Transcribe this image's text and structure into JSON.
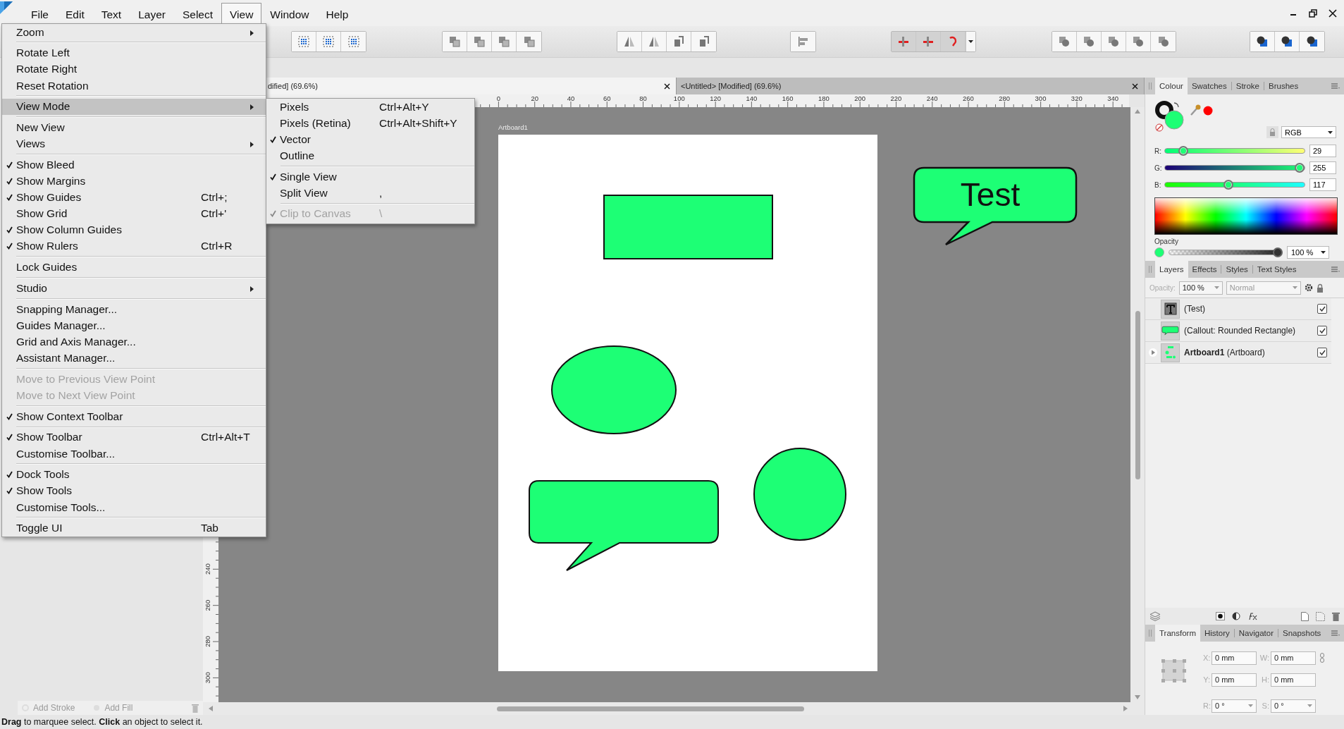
{
  "menubar": [
    {
      "label": "File",
      "selected": false
    },
    {
      "label": "Edit",
      "selected": false
    },
    {
      "label": "Text",
      "selected": false
    },
    {
      "label": "Layer",
      "selected": false
    },
    {
      "label": "Select",
      "selected": false
    },
    {
      "label": "View",
      "selected": true
    },
    {
      "label": "Window",
      "selected": false
    },
    {
      "label": "Help",
      "selected": false
    }
  ],
  "view_menu": {
    "groups": [
      [
        {
          "label": "Zoom",
          "checked": false,
          "disabled": false,
          "selected": false,
          "submenu": true
        }
      ],
      [
        {
          "label": "Rotate Left",
          "checked": false,
          "disabled": false,
          "selected": false,
          "submenu": false
        },
        {
          "label": "Rotate Right",
          "checked": false,
          "disabled": false,
          "selected": false,
          "submenu": false
        },
        {
          "label": "Reset Rotation",
          "checked": false,
          "disabled": false,
          "selected": false,
          "submenu": false
        }
      ],
      [
        {
          "label": "View Mode",
          "checked": false,
          "disabled": false,
          "selected": true,
          "submenu": true
        }
      ],
      [
        {
          "label": "New View",
          "checked": false,
          "disabled": false,
          "selected": false,
          "submenu": false
        },
        {
          "label": "Views",
          "checked": false,
          "disabled": false,
          "selected": false,
          "submenu": true
        }
      ],
      [
        {
          "label": "Show Bleed",
          "checked": true,
          "disabled": false,
          "selected": false,
          "submenu": false
        },
        {
          "label": "Show Margins",
          "checked": true,
          "disabled": false,
          "selected": false,
          "submenu": false
        },
        {
          "label": "Show Guides",
          "shortcut": "Ctrl+;",
          "checked": true,
          "disabled": false,
          "selected": false,
          "submenu": false
        },
        {
          "label": "Show Grid",
          "shortcut": "Ctrl+'",
          "checked": false,
          "disabled": false,
          "selected": false,
          "submenu": false
        },
        {
          "label": "Show Column Guides",
          "checked": true,
          "disabled": false,
          "selected": false,
          "submenu": false
        },
        {
          "label": "Show Rulers",
          "shortcut": "Ctrl+R",
          "checked": true,
          "disabled": false,
          "selected": false,
          "submenu": false
        }
      ],
      [
        {
          "label": "Lock Guides",
          "checked": false,
          "disabled": false,
          "selected": false,
          "submenu": false
        }
      ],
      [
        {
          "label": "Studio",
          "checked": false,
          "disabled": false,
          "selected": false,
          "submenu": true
        }
      ],
      [
        {
          "label": "Snapping Manager...",
          "checked": false,
          "disabled": false,
          "selected": false,
          "submenu": false
        },
        {
          "label": "Guides Manager...",
          "checked": false,
          "disabled": false,
          "selected": false,
          "submenu": false
        },
        {
          "label": "Grid and Axis Manager...",
          "checked": false,
          "disabled": false,
          "selected": false,
          "submenu": false
        },
        {
          "label": "Assistant Manager...",
          "checked": false,
          "disabled": false,
          "selected": false,
          "submenu": false
        }
      ],
      [
        {
          "label": "Move to Previous View Point",
          "checked": false,
          "disabled": true,
          "selected": false,
          "submenu": false
        },
        {
          "label": "Move to Next View Point",
          "checked": false,
          "disabled": true,
          "selected": false,
          "submenu": false
        }
      ],
      [
        {
          "label": "Show Context Toolbar",
          "checked": true,
          "disabled": false,
          "selected": false,
          "submenu": false
        }
      ],
      [
        {
          "label": "Show Toolbar",
          "shortcut": "Ctrl+Alt+T",
          "checked": true,
          "disabled": false,
          "selected": false,
          "submenu": false
        },
        {
          "label": "Customise Toolbar...",
          "checked": false,
          "disabled": false,
          "selected": false,
          "submenu": false
        }
      ],
      [
        {
          "label": "Dock Tools",
          "checked": true,
          "disabled": false,
          "selected": false,
          "submenu": false
        },
        {
          "label": "Show Tools",
          "checked": true,
          "disabled": false,
          "selected": false,
          "submenu": false
        },
        {
          "label": "Customise Tools...",
          "checked": false,
          "disabled": false,
          "selected": false,
          "submenu": false
        }
      ],
      [
        {
          "label": "Toggle UI",
          "shortcut": "Tab",
          "checked": false,
          "disabled": false,
          "selected": false,
          "submenu": false
        }
      ]
    ]
  },
  "view_mode_submenu": {
    "groups": [
      [
        {
          "label": "Pixels",
          "shortcut": "Ctrl+Alt+Y",
          "checked": false,
          "disabled": false
        },
        {
          "label": "Pixels (Retina)",
          "shortcut": "Ctrl+Alt+Shift+Y",
          "checked": false,
          "disabled": false
        },
        {
          "label": "Vector",
          "checked": true,
          "disabled": false
        },
        {
          "label": "Outline",
          "checked": false,
          "disabled": false
        }
      ],
      [
        {
          "label": "Single View",
          "checked": true,
          "disabled": false
        },
        {
          "label": "Split View",
          "shortcut": ",",
          "checked": false,
          "disabled": false
        }
      ],
      [
        {
          "label": "Clip to Canvas",
          "shortcut": "\\",
          "checked": true,
          "disabled": true
        }
      ]
    ]
  },
  "document_tabs": [
    {
      "title": "dified] (69.6%)",
      "selected": true
    },
    {
      "title": "<Untitled> [Modified] (69.6%)",
      "selected": false
    }
  ],
  "rulers": {
    "x_labels": [
      "0",
      "20",
      "40",
      "60",
      "80",
      "100",
      "120",
      "140",
      "160",
      "180",
      "200",
      "220",
      "240",
      "260",
      "280",
      "300",
      "320",
      "340"
    ],
    "y_labels": [
      "240",
      "260",
      "280",
      "300"
    ]
  },
  "canvas": {
    "artboard_label": "Artboard1",
    "callout_text": "Test"
  },
  "appearance_bar": {
    "add_stroke": "Add Stroke",
    "add_fill": "Add Fill"
  },
  "colour_panel": {
    "tabs": [
      {
        "label": "Colour",
        "selected": true
      },
      {
        "label": "Swatches",
        "selected": false
      },
      {
        "label": "Stroke",
        "selected": false
      },
      {
        "label": "Brushes",
        "selected": false
      }
    ],
    "model": "RGB",
    "channels": [
      {
        "name": "R:",
        "value": "29",
        "level": 0.114
      },
      {
        "name": "G:",
        "value": "255",
        "level": 1.0
      },
      {
        "name": "B:",
        "value": "117",
        "level": 0.459
      }
    ],
    "opacity_label": "Opacity",
    "opacity": {
      "value": "100 %",
      "level": 1.0
    }
  },
  "layers_panel": {
    "tabs": [
      {
        "label": "Layers",
        "selected": true
      },
      {
        "label": "Effects",
        "selected": false
      },
      {
        "label": "Styles",
        "selected": false
      },
      {
        "label": "Text Styles",
        "selected": false
      }
    ],
    "opacity_label": "Opacity:",
    "opacity": "100 %",
    "blend_mode": "Normal",
    "layers": [
      {
        "kind": "text",
        "name": "(Test)",
        "visible": true
      },
      {
        "kind": "shape",
        "name": "(Callout: Rounded Rectangle)",
        "visible": true
      },
      {
        "kind": "artboard",
        "name": "**Artboard1** (Artboard)",
        "visible": true,
        "expanded": false
      }
    ]
  },
  "transform_panel": {
    "tabs": [
      {
        "label": "Transform",
        "selected": true
      },
      {
        "label": "History",
        "selected": false
      },
      {
        "label": "Navigator",
        "selected": false
      },
      {
        "label": "Snapshots",
        "selected": false
      }
    ],
    "fields": [
      {
        "label": "X:",
        "value": "0 mm",
        "kind": "text"
      },
      {
        "label": "W:",
        "value": "0 mm",
        "kind": "text"
      },
      {
        "label": "Y:",
        "value": "0 mm",
        "kind": "text"
      },
      {
        "label": "H:",
        "value": "0 mm",
        "kind": "text"
      },
      {
        "label": "R:",
        "value": "0 °",
        "kind": "dropdown"
      },
      {
        "label": "S:",
        "value": "0 °",
        "kind": "dropdown"
      }
    ]
  },
  "status_bar": "**Drag** to marquee select. **Click** an object to select it."
}
